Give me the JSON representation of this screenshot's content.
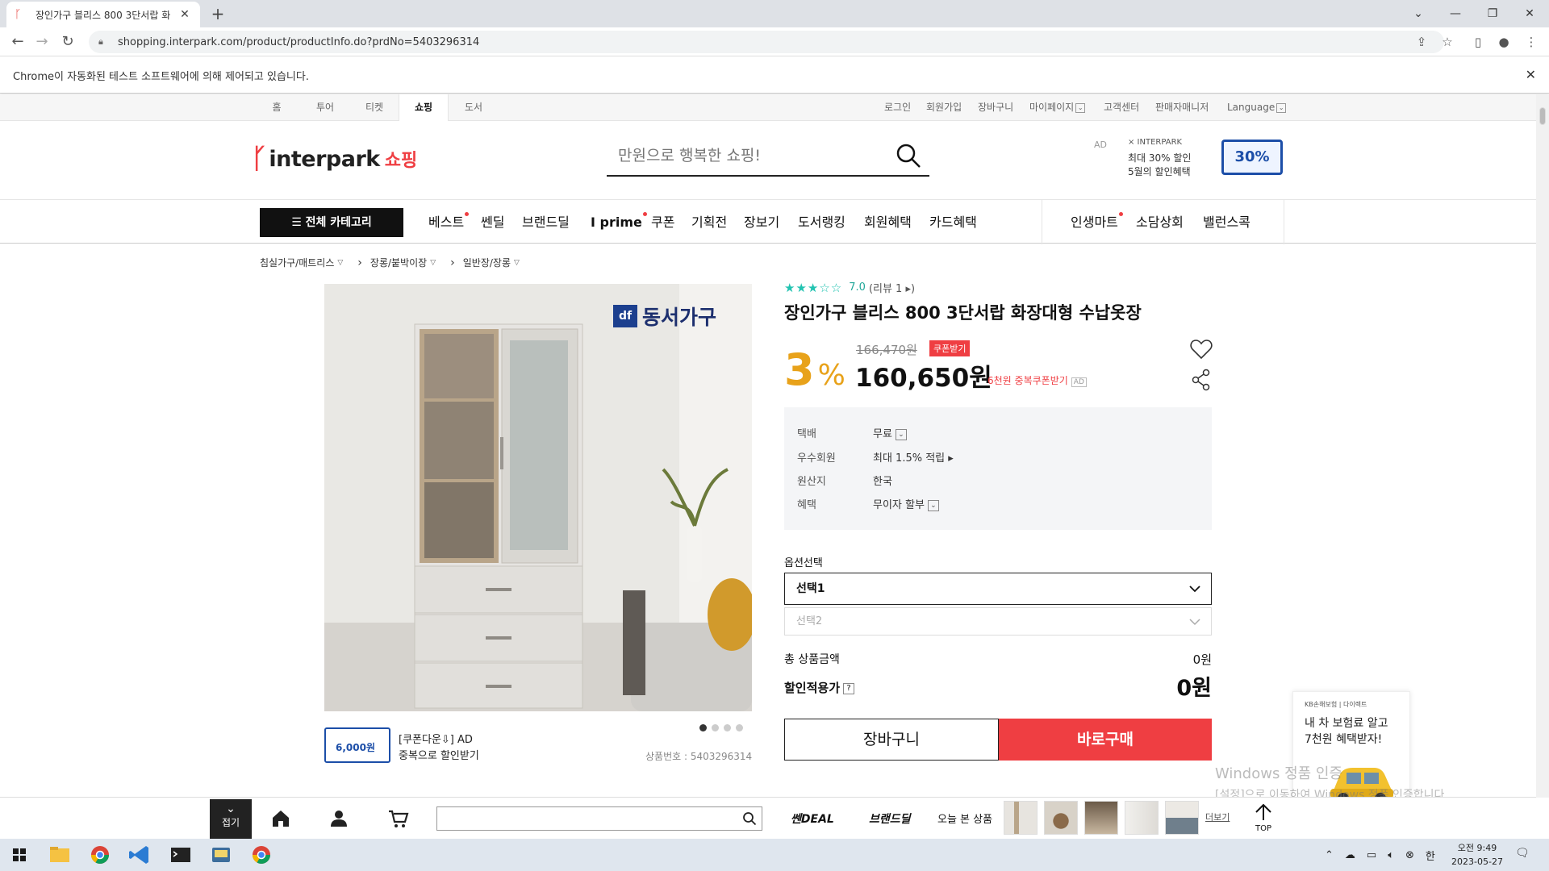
{
  "browser": {
    "tab_title": "장인가구 블리스 800 3단서랍 화",
    "url": "shopping.interpark.com/product/productInfo.do?prdNo=5403296314",
    "infobar": "Chrome이 자동화된 테스트 소프트웨어에 의해 제어되고 있습니다."
  },
  "gnb": {
    "tabs": [
      "홈",
      "투어",
      "티켓",
      "쇼핑",
      "도서"
    ],
    "active_tab": "쇼핑",
    "util": [
      "로그인",
      "회원가입",
      "장바구니",
      "마이페이지",
      "고객센터",
      "판매자매니저",
      "Language"
    ]
  },
  "header": {
    "logo_word": "interpark",
    "logo_sub": "쇼핑",
    "search_placeholder": "만원으로 행복한 쇼핑!",
    "ad": {
      "label": "AD",
      "brand": "× INTERPARK",
      "line1": "최대 30% 할인",
      "line2": "5월의 할인혜택",
      "badge": "30%"
    }
  },
  "catnav": {
    "all": "☰ 전체 카테고리",
    "items": [
      "베스트",
      "쎈딜",
      "브랜드딜",
      "I prime",
      "쿠폰",
      "기획전",
      "장보기",
      "도서랭킹",
      "회원혜택",
      "카드혜택"
    ],
    "right_items": [
      "인생마트",
      "소담상회",
      "밸런스콕"
    ]
  },
  "breadcrumb": [
    "침실가구/매트리스",
    "장롱/붙박이장",
    "일반장/장롱"
  ],
  "product": {
    "image_brand": "동서가구",
    "rating": "7.0",
    "reviews": "(리뷰 1 ▸)",
    "title": "장인가구 블리스 800 3단서랍 화장대형 수납옷장",
    "discount": "3",
    "discount_unit": "%",
    "old_price": "166,470원",
    "coupon_badge": "쿠폰받기",
    "price": "160,650원",
    "extra_coupon": "6천원 중복쿠폰받기",
    "extra_ad": "AD",
    "delivery": [
      {
        "k": "택배",
        "v": "무료"
      },
      {
        "k": "우수회원",
        "v": "최대 1.5% 적립 ▸"
      },
      {
        "k": "원산지",
        "v": "한국"
      },
      {
        "k": "혜택",
        "v": "무이자 할부"
      }
    ],
    "option_label": "옵션선택",
    "option1": "선택1",
    "option2": "선택2",
    "total_label": "총 상품금액",
    "total_value": "0원",
    "final_label": "할인적용가",
    "final_value": "0원",
    "cart_button": "장바구니",
    "buy_button": "바로구매",
    "coupon_box": "6,000원",
    "coupon_line1": "[쿠폰다운⇩] AD",
    "coupon_line2": "중복으로 할인받기",
    "product_no": "상품번호 : 5403296314"
  },
  "side_ad": {
    "brand": "KB손해보험 | 다이렉트",
    "line1": "내 차 보험료 알고",
    "line2": "7천원 혜택받자!"
  },
  "windows_watermark": {
    "line1": "Windows 정품 인증",
    "line2": "[설정]으로 이동하여 Windows 정품 인증합니다."
  },
  "bottombar": {
    "fold": "접기",
    "deal_logo": "쎈DEAL",
    "brand_logo": "브랜드딜",
    "recent": "오늘 본 상품",
    "more": "더보기",
    "top": "TOP"
  },
  "taskbar": {
    "time": "오전 9:49",
    "date": "2023-05-27",
    "ime": "한"
  },
  "colors": {
    "brand_red": "#ef3e42",
    "discount_orange": "#e8a21a",
    "star_teal": "#22c3b1"
  }
}
